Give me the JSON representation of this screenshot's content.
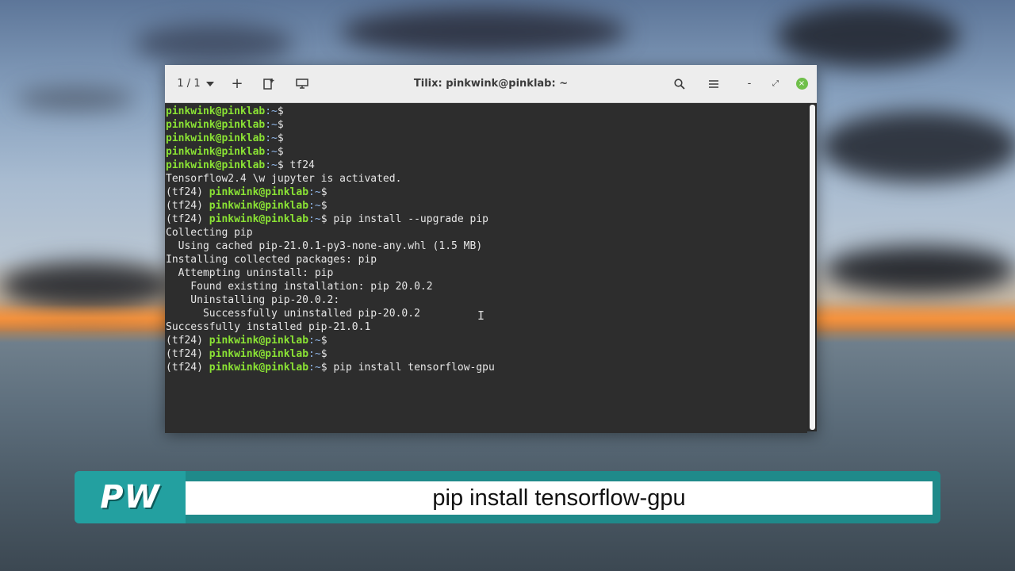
{
  "window": {
    "title": "Tilix: pinkwink@pinklab: ~",
    "session_counter": "1 / 1",
    "icons": [
      "chevron-down-icon",
      "plus-icon",
      "add-terminal-icon",
      "session-sync-icon",
      "search-icon",
      "hamburger-menu-icon",
      "minimize-icon",
      "maximize-icon",
      "close-icon"
    ],
    "minimize_glyph": "-",
    "maximize_glyph": "⤢",
    "close_glyph": "×",
    "add_glyph": "+"
  },
  "terminal": {
    "lines": [
      {
        "env": "",
        "user": "pinkwink@pinklab",
        "path": ":~",
        "prompt": "$ ",
        "text": ""
      },
      {
        "env": "",
        "user": "pinkwink@pinklab",
        "path": ":~",
        "prompt": "$ ",
        "text": ""
      },
      {
        "env": "",
        "user": "pinkwink@pinklab",
        "path": ":~",
        "prompt": "$ ",
        "text": ""
      },
      {
        "env": "",
        "user": "pinkwink@pinklab",
        "path": ":~",
        "prompt": "$ ",
        "text": ""
      },
      {
        "env": "",
        "user": "pinkwink@pinklab",
        "path": ":~",
        "prompt": "$ ",
        "text": "tf24"
      },
      {
        "env": "",
        "user": "",
        "path": "",
        "prompt": "",
        "text": "Tensorflow2.4 \\w jupyter is activated."
      },
      {
        "env": "(tf24) ",
        "user": "pinkwink@pinklab",
        "path": ":~",
        "prompt": "$ ",
        "text": ""
      },
      {
        "env": "(tf24) ",
        "user": "pinkwink@pinklab",
        "path": ":~",
        "prompt": "$ ",
        "text": ""
      },
      {
        "env": "(tf24) ",
        "user": "pinkwink@pinklab",
        "path": ":~",
        "prompt": "$ ",
        "text": "pip install --upgrade pip"
      },
      {
        "env": "",
        "user": "",
        "path": "",
        "prompt": "",
        "text": "Collecting pip"
      },
      {
        "env": "",
        "user": "",
        "path": "",
        "prompt": "",
        "text": "  Using cached pip-21.0.1-py3-none-any.whl (1.5 MB)"
      },
      {
        "env": "",
        "user": "",
        "path": "",
        "prompt": "",
        "text": "Installing collected packages: pip"
      },
      {
        "env": "",
        "user": "",
        "path": "",
        "prompt": "",
        "text": "  Attempting uninstall: pip"
      },
      {
        "env": "",
        "user": "",
        "path": "",
        "prompt": "",
        "text": "    Found existing installation: pip 20.0.2"
      },
      {
        "env": "",
        "user": "",
        "path": "",
        "prompt": "",
        "text": "    Uninstalling pip-20.0.2:"
      },
      {
        "env": "",
        "user": "",
        "path": "",
        "prompt": "",
        "text": "      Successfully uninstalled pip-20.0.2"
      },
      {
        "env": "",
        "user": "",
        "path": "",
        "prompt": "",
        "text": "Successfully installed pip-21.0.1"
      },
      {
        "env": "(tf24) ",
        "user": "pinkwink@pinklab",
        "path": ":~",
        "prompt": "$ ",
        "text": ""
      },
      {
        "env": "(tf24) ",
        "user": "pinkwink@pinklab",
        "path": ":~",
        "prompt": "$ ",
        "text": ""
      },
      {
        "env": "(tf24) ",
        "user": "pinkwink@pinklab",
        "path": ":~",
        "prompt": "$ ",
        "text": "pip install tensorflow-gpu"
      }
    ],
    "colors": {
      "user": "#8ae234",
      "path": "#8fb5e6",
      "text": "#e6e6e6",
      "background": "#2d2d2d"
    }
  },
  "banner": {
    "logo": "PW",
    "caption": "pip install tensorflow-gpu",
    "accent_color": "#23a0a0"
  }
}
